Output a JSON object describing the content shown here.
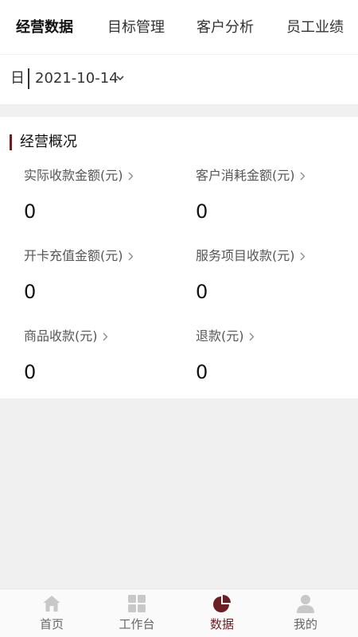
{
  "tabs": [
    {
      "label": "经营数据",
      "active": true
    },
    {
      "label": "目标管理"
    },
    {
      "label": "客户分析"
    },
    {
      "label": "员工业绩"
    }
  ],
  "date_filter": {
    "unit": "日",
    "value": "2021-10-14"
  },
  "overview": {
    "title": "经营概况",
    "metrics": [
      {
        "label": "实际收款金额(元)",
        "value": "0"
      },
      {
        "label": "客户消耗金额(元)",
        "value": "0"
      },
      {
        "label": "开卡充值金额(元)",
        "value": "0"
      },
      {
        "label": "服务项目收款(元)",
        "value": "0"
      },
      {
        "label": "商品收款(元)",
        "value": "0"
      },
      {
        "label": "退款(元)",
        "value": "0"
      }
    ]
  },
  "bottom_nav": [
    {
      "label": "首页",
      "icon": "home-icon"
    },
    {
      "label": "工作台",
      "icon": "grid-icon"
    },
    {
      "label": "数据",
      "icon": "pie-chart-icon",
      "active": true
    },
    {
      "label": "我的",
      "icon": "user-icon"
    }
  ],
  "colors": {
    "accent": "#6b1f22",
    "background": "#f0f0f0",
    "card": "#ffffff",
    "inactive_icon": "#c8c8c8"
  }
}
